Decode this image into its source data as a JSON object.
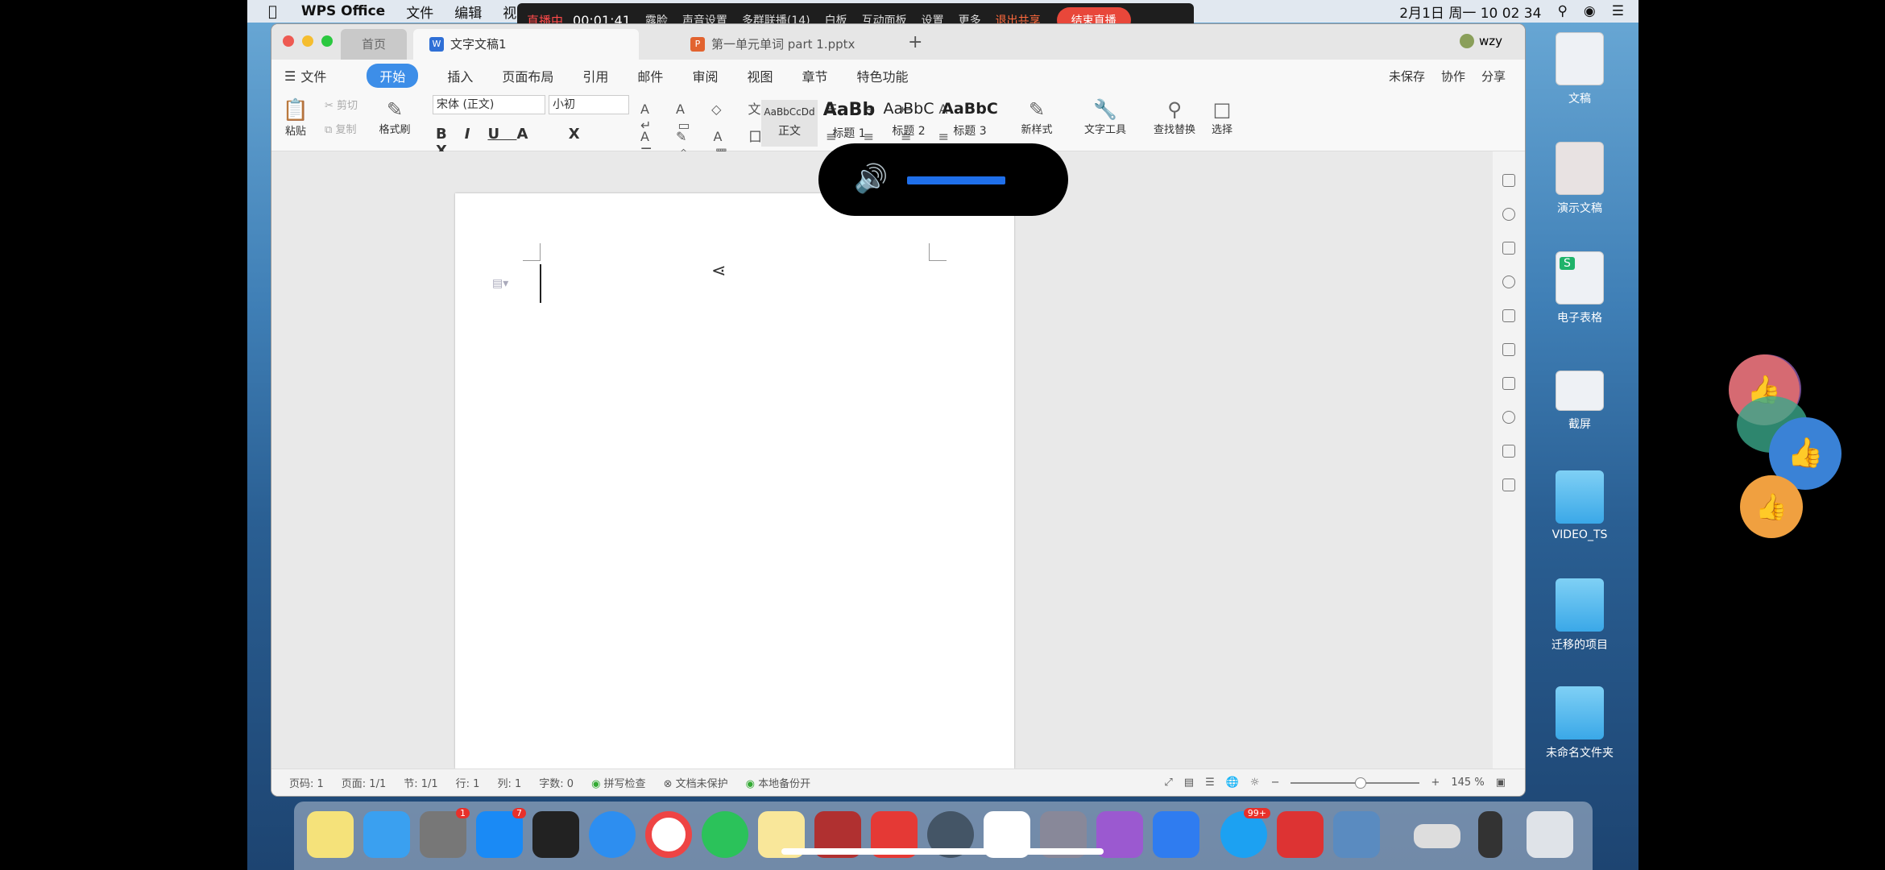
{
  "menubar": {
    "app": "WPS Office",
    "items": [
      "文件",
      "编辑",
      "视图"
    ],
    "clock": "2月1日 周一  10 02 34"
  },
  "livebar": {
    "status": "直播中",
    "time": "00:01:41",
    "items": [
      "露脸",
      "声音设置",
      "多群联播(14)",
      "白板",
      "互动面板",
      "设置",
      "更多"
    ],
    "exit": "退出共享",
    "end": "结束直播"
  },
  "window": {
    "tabs": {
      "home": "首页",
      "doc": "文字文稿1",
      "ppt": "第一单元单词 part 1.pptx"
    },
    "user": "wzy",
    "menu": {
      "file": "文件",
      "items": [
        "开始",
        "插入",
        "页面布局",
        "引用",
        "邮件",
        "审阅",
        "视图",
        "章节",
        "特色功能"
      ],
      "right": [
        "未保存",
        "协作",
        "分享"
      ]
    },
    "ribbon": {
      "paste": "粘贴",
      "cut": "剪切",
      "copy": "复制",
      "format_painter": "格式刷",
      "font": "宋体 (正文)",
      "size": "小初",
      "styles": [
        {
          "preview": "AaBbCcDd",
          "label": "正文"
        },
        {
          "preview": "AaBb",
          "label": "标题 1"
        },
        {
          "preview": "AaBbC",
          "label": "标题 2"
        },
        {
          "preview": "AaBbC",
          "label": "标题 3"
        }
      ],
      "new_style": "新样式",
      "text_tools": "文字工具",
      "find_replace": "查找替换",
      "select": "选择"
    },
    "status": {
      "page": "页码: 1",
      "pages": "页面: 1/1",
      "section": "节: 1/1",
      "row": "行: 1",
      "col": "列: 1",
      "words": "字数: 0",
      "spell": "拼写检查",
      "protect": "文档未保护",
      "backup": "本地备份开",
      "zoom": "145 %"
    }
  },
  "desktop": [
    {
      "label": "文稿",
      "type": "file"
    },
    {
      "label": "演示文稿",
      "type": "file"
    },
    {
      "label": "电子表格",
      "type": "sheet"
    },
    {
      "label": "截屏",
      "type": "file"
    },
    {
      "label": "VIDEO_TS",
      "type": "folder"
    },
    {
      "label": "迁移的项目",
      "type": "folder"
    },
    {
      "label": "未命名文件夹",
      "type": "folder"
    }
  ],
  "dock": {
    "badges": {
      "settings": "1",
      "appstore": "7",
      "qq": "99+"
    }
  },
  "volume": {
    "level": 0.5
  }
}
